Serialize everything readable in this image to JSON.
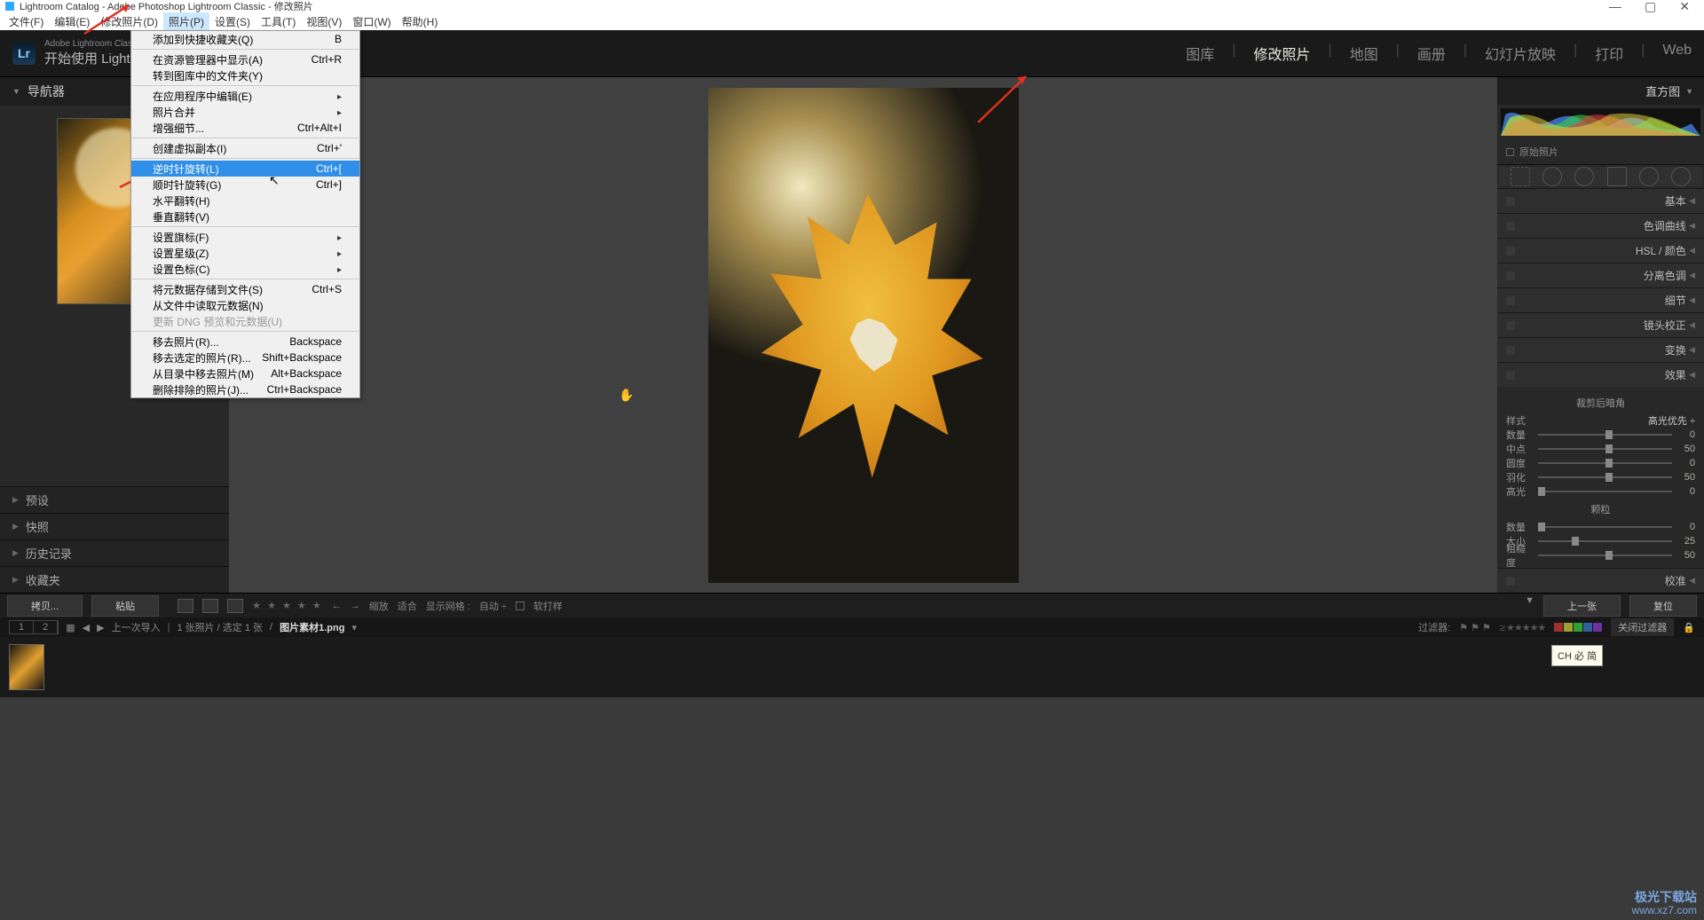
{
  "title_bar": {
    "text": "Lightroom Catalog - Adobe Photoshop Lightroom Classic - 修改照片"
  },
  "window_controls": {
    "min": "—",
    "max": "▢",
    "close": "✕"
  },
  "menu_bar": {
    "items": [
      "文件(F)",
      "编辑(E)",
      "修改照片(D)",
      "照片(P)",
      "设置(S)",
      "工具(T)",
      "视图(V)",
      "窗口(W)",
      "帮助(H)"
    ],
    "active_index": 3
  },
  "dropdown": {
    "items": [
      {
        "label": "添加到快捷收藏夹(Q)",
        "shortcut": "B"
      },
      {
        "sep": true
      },
      {
        "label": "在资源管理器中显示(A)",
        "shortcut": "Ctrl+R"
      },
      {
        "label": "转到图库中的文件夹(Y)",
        "shortcut": ""
      },
      {
        "sep": true
      },
      {
        "label": "在应用程序中编辑(E)",
        "shortcut": "",
        "arrow": true
      },
      {
        "label": "照片合并",
        "shortcut": "",
        "arrow": true
      },
      {
        "label": "增强细节...",
        "shortcut": "Ctrl+Alt+I"
      },
      {
        "sep": true
      },
      {
        "label": "创建虚拟副本(I)",
        "shortcut": "Ctrl+'"
      },
      {
        "sep": true
      },
      {
        "label": "逆时针旋转(L)",
        "shortcut": "Ctrl+[",
        "hl": true
      },
      {
        "label": "顺时针旋转(G)",
        "shortcut": "Ctrl+]"
      },
      {
        "label": "水平翻转(H)",
        "shortcut": ""
      },
      {
        "label": "垂直翻转(V)",
        "shortcut": ""
      },
      {
        "sep": true
      },
      {
        "label": "设置旗标(F)",
        "shortcut": "",
        "arrow": true
      },
      {
        "label": "设置星级(Z)",
        "shortcut": "",
        "arrow": true
      },
      {
        "label": "设置色标(C)",
        "shortcut": "",
        "arrow": true
      },
      {
        "sep": true
      },
      {
        "label": "将元数据存储到文件(S)",
        "shortcut": "Ctrl+S"
      },
      {
        "label": "从文件中读取元数据(N)",
        "shortcut": ""
      },
      {
        "label": "更新 DNG 预览和元数据(U)",
        "shortcut": "",
        "disabled": true
      },
      {
        "sep": true
      },
      {
        "label": "移去照片(R)...",
        "shortcut": "Backspace"
      },
      {
        "label": "移去选定的照片(R)...",
        "shortcut": "Shift+Backspace"
      },
      {
        "label": "从目录中移去照片(M)",
        "shortcut": "Alt+Backspace"
      },
      {
        "label": "删除排除的照片(J)...",
        "shortcut": "Ctrl+Backspace"
      }
    ]
  },
  "brand": {
    "logo": "Lr",
    "sub": "Adobe Lightroom Classic",
    "main": "开始使用 Lightr"
  },
  "modules": {
    "items": [
      "图库",
      "修改照片",
      "地图",
      "画册",
      "幻灯片放映",
      "打印",
      "Web"
    ],
    "active_index": 1
  },
  "left_panel": {
    "navigator": "导航器",
    "sections": [
      "预设",
      "快照",
      "历史记录",
      "收藏夹"
    ]
  },
  "right_panel": {
    "histogram_label": "直方图",
    "orig": "原始照片",
    "sections": [
      "基本",
      "色调曲线",
      "HSL / 颜色",
      "分离色调",
      "细节",
      "镜头校正",
      "变换",
      "效果",
      "校准"
    ],
    "effects": {
      "group1_title": "裁剪后暗角",
      "style_label": "样式",
      "style_value": "高光优先 ÷",
      "sliders1": [
        {
          "label": "数量",
          "val": "0",
          "pos": 50
        },
        {
          "label": "中点",
          "val": "50",
          "pos": 50
        },
        {
          "label": "圆度",
          "val": "0",
          "pos": 50
        },
        {
          "label": "羽化",
          "val": "50",
          "pos": 50
        },
        {
          "label": "高光",
          "val": "0",
          "pos": 0
        }
      ],
      "group2_title": "颗粒",
      "sliders2": [
        {
          "label": "数量",
          "val": "0",
          "pos": 0
        },
        {
          "label": "大小",
          "val": "25",
          "pos": 25
        },
        {
          "label": "粗糙度",
          "val": "50",
          "pos": 50
        }
      ]
    }
  },
  "toolbar": {
    "copy": "拷贝...",
    "paste": "粘贴",
    "zoom_label": "缩放",
    "fit": "适合",
    "grid_label": "显示网格 :",
    "auto": "自动 ÷",
    "soft_proof": "软打样",
    "prev": "上一张",
    "reset": "复位"
  },
  "filter_bar": {
    "n1": "1",
    "n2": "2",
    "import": "上一次导入",
    "count": "1 张照片 / 选定 1 张",
    "filename": "图片素材1.png",
    "sep": "/",
    "filter_label": "过滤器:",
    "close": "关闭过滤器"
  },
  "ime": "CH 必 简",
  "watermark": {
    "big": "极光下载站",
    "small": "www.xz7.com"
  }
}
